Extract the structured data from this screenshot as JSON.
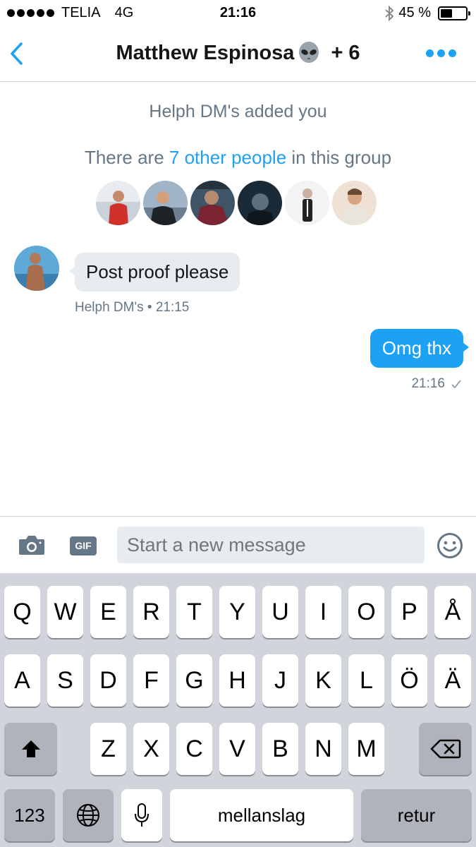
{
  "status_bar": {
    "carrier": "TELIA",
    "network": "4G",
    "time": "21:16",
    "battery": "45 %",
    "battery_level": 0.45
  },
  "nav": {
    "title": "Matthew Espinosa",
    "participants_extra": "+ 6",
    "accent_color": "#1da1f2"
  },
  "conversation": {
    "system_message": "Helph DM's added you",
    "group_info_prefix": "There are",
    "group_info_link": "7 other people",
    "group_info_suffix": "in this group",
    "messages": [
      {
        "direction": "incoming",
        "text": "Post proof please",
        "sender": "Helph DM's",
        "separator": "•",
        "time": "21:15"
      },
      {
        "direction": "outgoing",
        "text": "Omg thx",
        "time": "21:16",
        "status_icon": "checkmark-icon"
      }
    ]
  },
  "composer": {
    "placeholder": "Start a new message",
    "gif_label": "GIF"
  },
  "keyboard": {
    "row1": [
      "Q",
      "W",
      "E",
      "R",
      "T",
      "Y",
      "U",
      "I",
      "O",
      "P",
      "Å"
    ],
    "row2": [
      "A",
      "S",
      "D",
      "F",
      "G",
      "H",
      "J",
      "K",
      "L",
      "Ö",
      "Ä"
    ],
    "row3": [
      "Z",
      "X",
      "C",
      "V",
      "B",
      "N",
      "M"
    ],
    "numbers_label": "123",
    "space_label": "mellanslag",
    "return_label": "retur"
  }
}
